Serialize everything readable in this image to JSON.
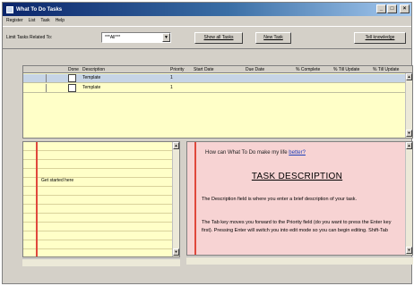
{
  "window": {
    "title": "What To Do Tasks"
  },
  "titlebar_buttons": {
    "minimize": "_",
    "maximize": "□",
    "close": "×"
  },
  "menu": [
    "Register",
    "List",
    "Task",
    "Help"
  ],
  "toolbar": {
    "filter_label": "Limit Tasks Related To:",
    "filter_value": "***All***",
    "show_all_label": "Show all Tasks",
    "new_task_label": "New Task",
    "knowledge_label": "Tell knowledge"
  },
  "grid": {
    "columns": [
      "Done",
      "Description",
      "Priority",
      "Start Date",
      "Due Date",
      "% Complete",
      "% Till Update",
      "% Till Update"
    ],
    "rows": [
      {
        "description": "Template",
        "priority": "1",
        "selected": true
      },
      {
        "description": "Template",
        "priority": "1",
        "selected": false
      }
    ]
  },
  "notes": {
    "text": "Get started here"
  },
  "help": {
    "question_prefix": "How can What To Do make my life ",
    "question_link": "better?",
    "title": "TASK DESCRIPTION",
    "para1": "The Description field is where you enter a brief description of your task.",
    "para2": "The Tab key moves you forward to the Priority field (do you want to press the Enter key first). Pressing Enter will switch you into edit mode so you can begin editing. Shift-Tab"
  },
  "colors": {
    "title_start": "#0a246a",
    "grid_bg": "#ffffc8",
    "help_bg": "#f7d3d3",
    "margin_line": "#e0483c"
  }
}
